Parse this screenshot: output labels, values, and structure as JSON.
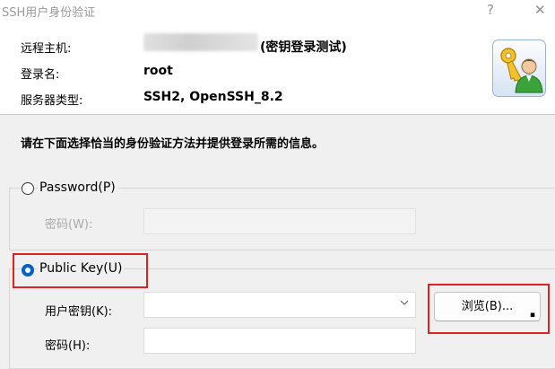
{
  "window": {
    "title": "SSH用户身份验证",
    "help_label": "?",
    "close_label": "✕"
  },
  "info": {
    "host_label": "远程主机:",
    "host_value": "(密钥登录测试)",
    "login_label": "登录名:",
    "login_value": "root",
    "server_type_label": "服务器类型:",
    "server_type_value": "SSH2, OpenSSH_8.2",
    "icon": "keys-user-icon"
  },
  "instruction": "请在下面选择恰当的身份验证方法并提供登录所需的信息。",
  "password_method": {
    "label": "Password(P)",
    "selected": false,
    "password_label": "密码(W):",
    "password_value": ""
  },
  "publickey_method": {
    "label": "Public Key(U)",
    "selected": true,
    "key_label": "用户密钥(K):",
    "key_value": "",
    "browse_label": "浏览(B)...",
    "passphrase_label": "密码(H):",
    "passphrase_value": ""
  },
  "colors": {
    "accent": "#0062c3",
    "highlight": "#e02121"
  }
}
